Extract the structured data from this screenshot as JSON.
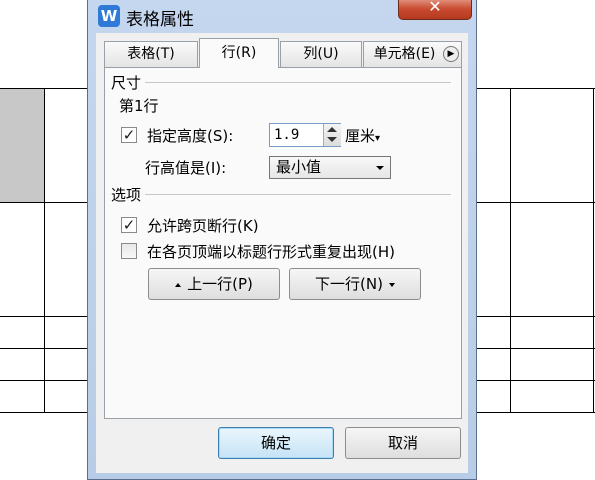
{
  "window": {
    "title": "表格属性",
    "app_icon_letter": "W",
    "close_symbol": "✕"
  },
  "tabs": [
    {
      "label": "表格(T)",
      "active": false
    },
    {
      "label": "行(R)",
      "active": true
    },
    {
      "label": "列(U)",
      "active": false
    },
    {
      "label": "单元格(E)",
      "active": false
    }
  ],
  "tabs_scroll_symbol": "▶",
  "size_group": {
    "label": "尺寸",
    "row_label": "第1行",
    "specify_height": {
      "label": "指定高度(S):",
      "checked": true,
      "check_mark": "✓"
    },
    "height_value": "1.9",
    "unit": "厘米",
    "unit_arrow": "▾",
    "row_height_is_label": "行高值是(I):",
    "row_height_mode": "最小值"
  },
  "options_group": {
    "label": "选项",
    "allow_break": {
      "label": "允许跨页断行(K)",
      "checked": true,
      "check_mark": "✓"
    },
    "repeat_header": {
      "label": "在各页顶端以标题行形式重复出现(H)",
      "checked": false
    }
  },
  "nav": {
    "prev_label": "上一行(P)",
    "next_label": "下一行(N)"
  },
  "footer": {
    "ok_label": "确定",
    "cancel_label": "取消"
  },
  "colors": {
    "titlebar": "#c5d7ee",
    "close_button": "#c84a2f",
    "default_button_border": "#3c7fb1",
    "table_shade": "#c8c8c8"
  }
}
